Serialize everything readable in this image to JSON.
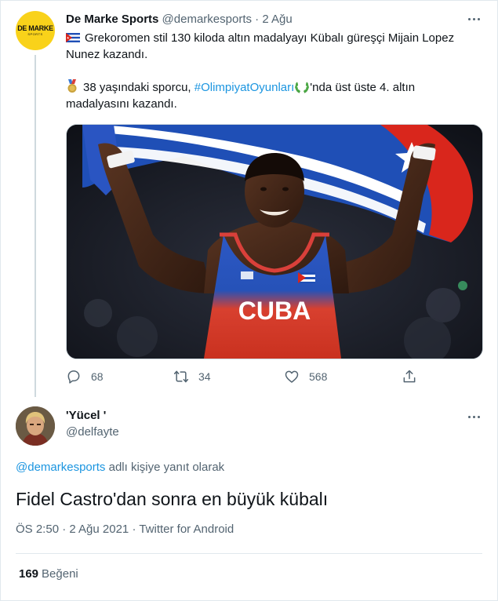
{
  "tweet": {
    "avatar_text": "DE MARKE",
    "avatar_subtext": "SPORTS",
    "name": "De Marke Sports",
    "handle": "@demarkesports",
    "separator": "·",
    "date": "2 Ağu",
    "line1": "Grekoromen stil 130 kiloda altın madalyayı Kübalı güreşçi Mijain Lopez Nunez kazandı.",
    "line2_before": "38 yaşındaki sporcu, ",
    "hashtag": "#OlimpiyatOyunları",
    "line2_after": "'nda üst üste 4. altın madalyasını kazandı.",
    "image_jersey_text": "CUBA",
    "replies": "68",
    "retweets": "34",
    "likes": "568"
  },
  "reply": {
    "name": "'Yücel '",
    "handle": "@delfayte",
    "replying_mention": "@demarkesports",
    "replying_rest": " adlı kişiye yanıt olarak",
    "text": "Fidel Castro'dan sonra en büyük kübalı",
    "meta": "ÖS 2:50 · 2 Ağu 2021 · Twitter for Android",
    "like_count": "169",
    "like_label": "Beğeni"
  },
  "colors": {
    "link": "#1b95e0",
    "secondary": "#536471",
    "avatar_yellow": "#f9d21a",
    "cuba_blue": "#1f4fb6",
    "cuba_red": "#d9261c"
  },
  "icons": [
    "cuba-flag-icon",
    "medal-icon",
    "laurel-icon",
    "more-icon",
    "reply-icon",
    "retweet-icon",
    "like-icon",
    "share-icon"
  ]
}
